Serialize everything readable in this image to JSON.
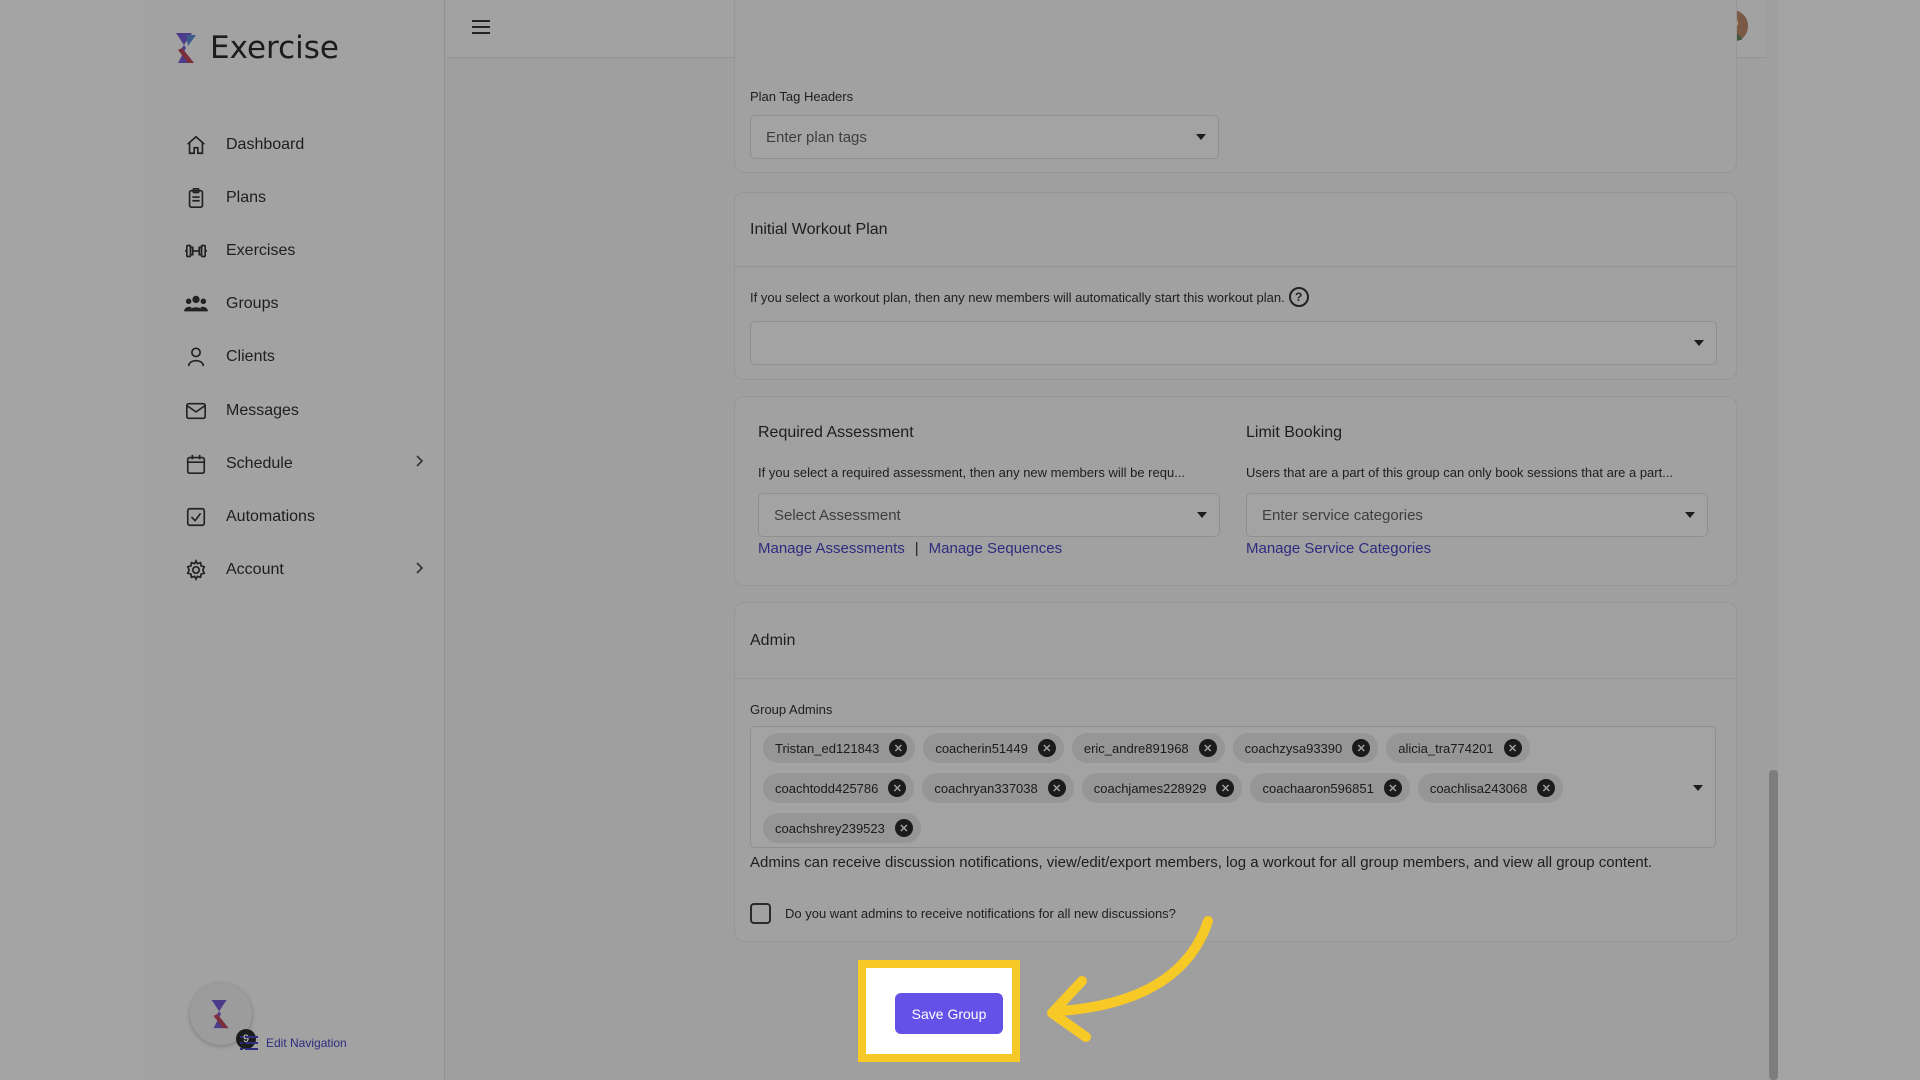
{
  "app": {
    "name": "Exercise"
  },
  "sidebar": {
    "items": [
      {
        "label": "Dashboard",
        "icon": "home-icon",
        "chevron": false
      },
      {
        "label": "Plans",
        "icon": "clipboard-icon",
        "chevron": false
      },
      {
        "label": "Exercises",
        "icon": "dumbbell-icon",
        "chevron": false
      },
      {
        "label": "Groups",
        "icon": "users-icon",
        "chevron": false
      },
      {
        "label": "Clients",
        "icon": "user-icon",
        "chevron": false
      },
      {
        "label": "Messages",
        "icon": "mail-icon",
        "chevron": false
      },
      {
        "label": "Schedule",
        "icon": "calendar-icon",
        "chevron": true
      },
      {
        "label": "Automations",
        "icon": "checkbox-icon",
        "chevron": false
      },
      {
        "label": "Account",
        "icon": "gear-icon",
        "chevron": true
      }
    ],
    "badge_count": "9",
    "edit_navigation": "Edit Navigation"
  },
  "plan_tags": {
    "label": "Plan Tag Headers",
    "placeholder": "Enter plan tags"
  },
  "initial_workout": {
    "title": "Initial Workout Plan",
    "description": "If you select a workout plan, then any new members will automatically start this workout plan.",
    "help_icon": "?"
  },
  "required_assessment": {
    "title": "Required Assessment",
    "description": "If you select a required assessment, then any new members will be requ...",
    "placeholder": "Select Assessment",
    "link_assessments": "Manage Assessments",
    "separator": "|",
    "link_sequences": "Manage Sequences"
  },
  "limit_booking": {
    "title": "Limit Booking",
    "description": "Users that are a part of this group can only book sessions that are a part...",
    "placeholder": "Enter service categories",
    "link_categories": "Manage Service Categories"
  },
  "admin": {
    "title": "Admin",
    "group_admins_label": "Group Admins",
    "chips": [
      "Tristan_ed121843",
      "coacherin51449",
      "eric_andre891968",
      "coachzysa93390",
      "alicia_tra774201",
      "coachtodd425786",
      "coachryan337038",
      "coachjames228929",
      "coachaaron596851",
      "coachlisa243068",
      "coachshrey239523"
    ],
    "chip_remove": "✕",
    "info": "Admins can receive discussion notifications, view/edit/export members, log a workout for all group members, and view all group content.",
    "notify_question": "Do you want admins to receive notifications for all new discussions?"
  },
  "actions": {
    "save_label": "Save Group"
  },
  "colors": {
    "accent": "#6452e8",
    "highlight": "#f6c927",
    "link": "#2e2c7e"
  }
}
